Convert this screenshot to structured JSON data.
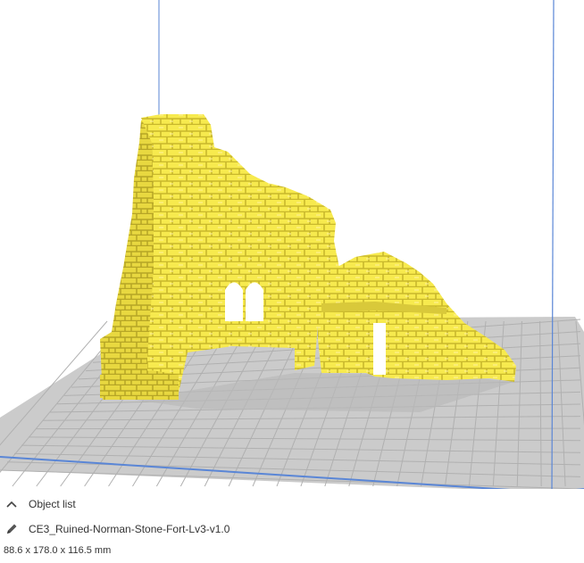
{
  "colors": {
    "model": "#f7ea4e",
    "model_shadow": "#d4c532",
    "build_plate": "#c8c8c8",
    "grid_line": "#aaaaaa",
    "volume_edge": "#4a78c8"
  },
  "object_list": {
    "toggle_icon": "chevron-up-icon",
    "label": "Object list"
  },
  "object": {
    "edit_icon": "pencil-icon",
    "name": "CE3_Ruined-Norman-Stone-Fort-Lv3-v1.0",
    "dimensions": "88.6 x 178.0 x 116.5 mm"
  }
}
